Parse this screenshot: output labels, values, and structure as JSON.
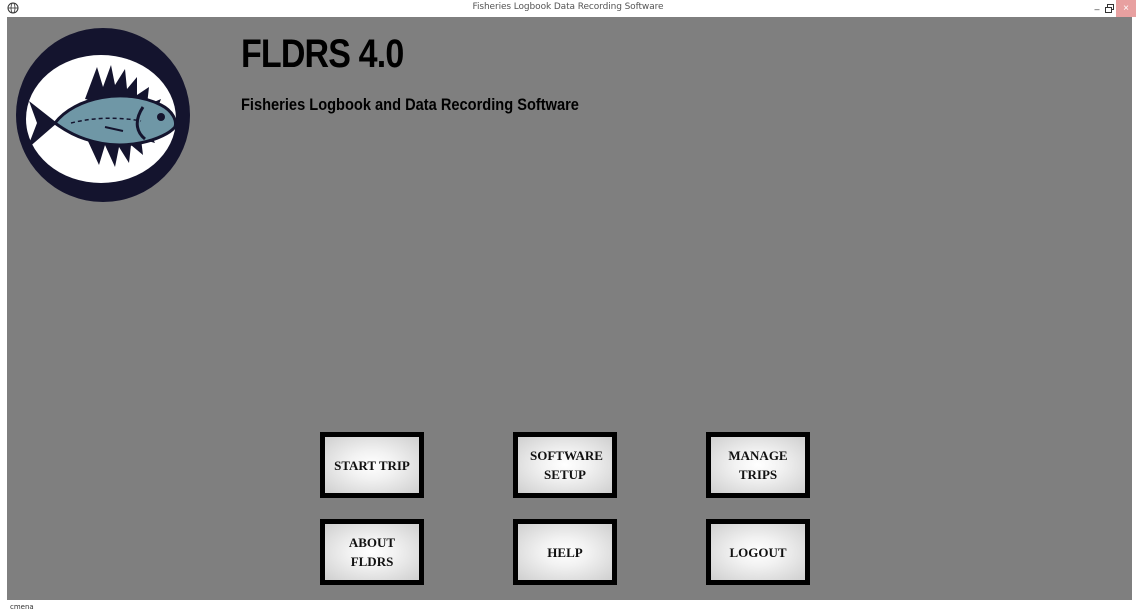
{
  "window": {
    "title": "Fisheries Logbook Data Recording Software",
    "icon": "app-globe-icon",
    "controls": {
      "minimize": "–",
      "maximize_icon": "restore-icon",
      "close": "×"
    }
  },
  "header": {
    "logo": "fish-logo-icon",
    "title": "FLDRS 4.0",
    "subtitle": "Fisheries Logbook and Data Recording Software"
  },
  "menu": {
    "start_trip": "START TRIP",
    "software_setup": "SOFTWARE SETUP",
    "manage_trips": "MANAGE TRIPS",
    "about_fldrs": "ABOUT FLDRS",
    "help": "HELP",
    "logout": "LOGOUT"
  },
  "status": {
    "text": "cmena"
  },
  "colors": {
    "background": "#7f7f7f",
    "logo_ring": "#14142e",
    "fish": "#6f97a6",
    "close_button": "#e8a0a0"
  }
}
